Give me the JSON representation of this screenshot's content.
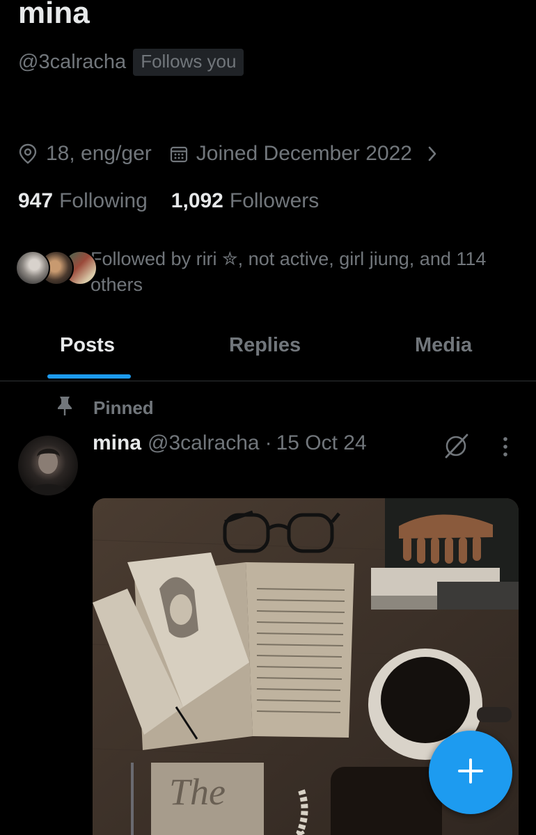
{
  "profile": {
    "display_name": "mina",
    "handle": "@3calracha",
    "follows_you_badge": "Follows you",
    "location": "18, eng/ger",
    "joined": "Joined December 2022",
    "stats": [
      {
        "value": "947",
        "label": "Following"
      },
      {
        "value": "1,092",
        "label": "Followers"
      }
    ],
    "followed_by_text": "Followed by riri ✮, not active, girl jiung, and 114 others"
  },
  "tabs": [
    {
      "label": "Posts",
      "active": true
    },
    {
      "label": "Replies",
      "active": false
    },
    {
      "label": "Media",
      "active": false
    }
  ],
  "post": {
    "pinned_label": "Pinned",
    "author_name": "mina",
    "author_handle": "@3calracha",
    "separator": "·",
    "date": "15 Oct 24",
    "media_description_icons": [
      "glasses",
      "sketchbook",
      "open-book",
      "coffee-cup",
      "comb",
      "pencil"
    ]
  },
  "icons": {
    "location": "location-pin-icon",
    "calendar": "calendar-icon",
    "chevron": "chevron-right-icon",
    "pin": "pin-icon",
    "grok": "grok-icon",
    "more": "more-vertical-icon",
    "compose": "plus-icon"
  },
  "colors": {
    "background": "#000000",
    "primary_text": "#e7e9ea",
    "secondary_text": "#71767b",
    "accent": "#1d9bf0",
    "divider": "#2f3336"
  }
}
